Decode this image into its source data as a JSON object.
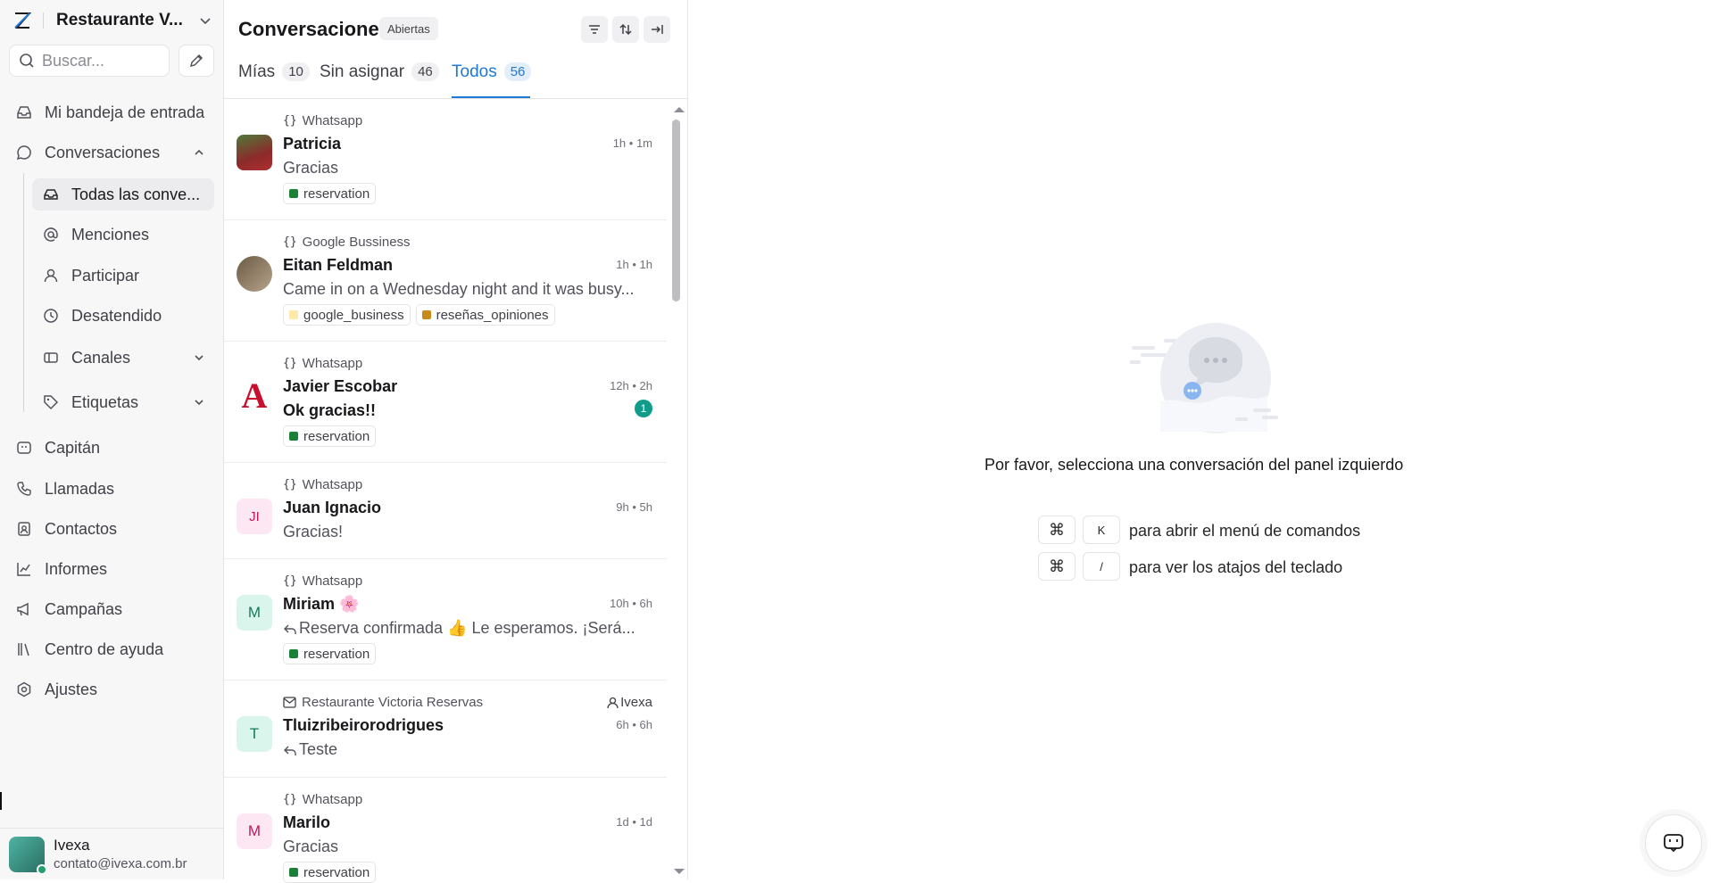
{
  "account": {
    "name": "Restaurante V..."
  },
  "search": {
    "placeholder": "Buscar..."
  },
  "sidebar": {
    "items": [
      {
        "label": "Mi bandeja de entrada",
        "icon": "inbox-icon"
      },
      {
        "label": "Conversaciones",
        "icon": "chat-bubble-icon"
      },
      {
        "label": "Todas las conve...",
        "icon": "inbox-tray-icon"
      },
      {
        "label": "Menciones",
        "icon": "at-sign-icon"
      },
      {
        "label": "Participar",
        "icon": "user-icon"
      },
      {
        "label": "Desatendido",
        "icon": "clock-icon"
      },
      {
        "label": "Canales",
        "icon": "channels-icon"
      },
      {
        "label": "Etiquetas",
        "icon": "tag-icon"
      },
      {
        "label": "Capitán",
        "icon": "bot-icon"
      },
      {
        "label": "Llamadas",
        "icon": "phone-icon"
      },
      {
        "label": "Contactos",
        "icon": "contacts-icon"
      },
      {
        "label": "Informes",
        "icon": "chart-icon"
      },
      {
        "label": "Campañas",
        "icon": "megaphone-icon"
      },
      {
        "label": "Centro de ayuda",
        "icon": "library-icon"
      },
      {
        "label": "Ajustes",
        "icon": "settings-icon"
      }
    ]
  },
  "user": {
    "name": "Ivexa",
    "email": "contato@ivexa.com.br"
  },
  "list": {
    "title": "Conversaciones",
    "status_badge": "Abiertas",
    "tabs": [
      {
        "label": "Mías",
        "count": "10"
      },
      {
        "label": "Sin asignar",
        "count": "46"
      },
      {
        "label": "Todos",
        "count": "56"
      }
    ],
    "conversations": [
      {
        "inbox": "Whatsapp",
        "name": "Patricia",
        "message": "Gracias",
        "time": "1h • 1m",
        "tags": [
          {
            "label": "reservation",
            "color": "#1a7f37"
          }
        ]
      },
      {
        "inbox": "Google Bussiness",
        "name": "Eitan Feldman",
        "message": "Came in on a Wednesday night and it was busy...",
        "time": "1h • 1h",
        "tags": [
          {
            "label": "google_business",
            "color": "#fde9a8"
          },
          {
            "label": "reseñas_opiniones",
            "color": "#c98a1a"
          }
        ]
      },
      {
        "inbox": "Whatsapp",
        "name": "Javier Escobar",
        "message": "Ok gracias!!",
        "time": "12h • 2h",
        "unread": "1",
        "tags": [
          {
            "label": "reservation",
            "color": "#1a7f37"
          }
        ]
      },
      {
        "inbox": "Whatsapp",
        "name": "Juan Ignacio",
        "message": "Gracias!",
        "time": "9h • 5h",
        "initials": "JI"
      },
      {
        "inbox": "Whatsapp",
        "name": "Miriam 🌸",
        "message": "Reserva confirmada 👍 Le esperamos. ¡Será...",
        "time": "10h • 6h",
        "initials": "M",
        "tags": [
          {
            "label": "reservation",
            "color": "#1a7f37"
          }
        ]
      },
      {
        "inbox": "Restaurante Victoria Reservas",
        "name": "Tluizribeirorodrigues",
        "message": "Teste",
        "time": "6h • 6h",
        "initials": "T",
        "assignee": "Ivexa"
      },
      {
        "inbox": "Whatsapp",
        "name": "Marilo",
        "message": "Gracias",
        "time": "1d • 1d",
        "initials": "M",
        "tags": [
          {
            "label": "reservation",
            "color": "#1a7f37"
          }
        ]
      }
    ]
  },
  "empty_state": {
    "message": "Por favor, selecciona una conversación del panel izquierdo",
    "shortcuts": [
      {
        "keys": [
          "⌘",
          "K"
        ],
        "label": "para abrir el menú de comandos"
      },
      {
        "keys": [
          "⌘",
          "/"
        ],
        "label": "para ver los atajos del teclado"
      }
    ]
  },
  "colors": {
    "accent": "#1f78d1",
    "unread_badge": "#0f9d8a",
    "sidebar_bg": "#f7f7f8"
  }
}
